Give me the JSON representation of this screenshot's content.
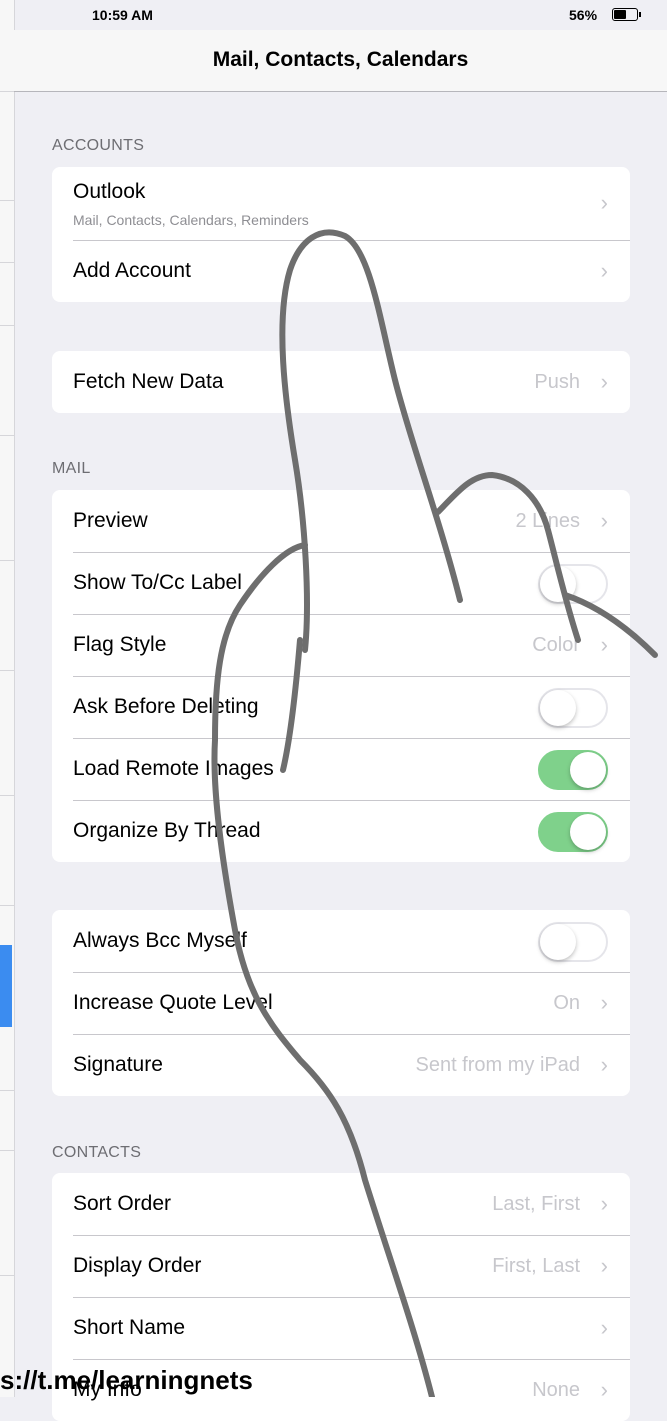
{
  "status_bar": {
    "time": "10:59 AM",
    "battery_percent": "56%",
    "battery_level": 0.56
  },
  "nav": {
    "title": "Mail, Contacts, Calendars"
  },
  "sections": {
    "accounts": {
      "header": "ACCOUNTS",
      "rows": [
        {
          "label": "Outlook",
          "subtitle": "Mail, Contacts, Calendars, Reminders"
        },
        {
          "label": "Add Account"
        }
      ]
    },
    "fetch": {
      "rows": [
        {
          "label": "Fetch New Data",
          "value": "Push"
        }
      ]
    },
    "mail": {
      "header": "MAIL",
      "rows": [
        {
          "label": "Preview",
          "value": "2 Lines"
        },
        {
          "label": "Show To/Cc Label",
          "toggle": false
        },
        {
          "label": "Flag Style",
          "value": "Color"
        },
        {
          "label": "Ask Before Deleting",
          "toggle": false
        },
        {
          "label": "Load Remote Images",
          "toggle": true
        },
        {
          "label": "Organize By Thread",
          "toggle": true
        }
      ]
    },
    "compose": {
      "rows": [
        {
          "label": "Always Bcc Myself",
          "toggle": false
        },
        {
          "label": "Increase Quote Level",
          "value": "On"
        },
        {
          "label": "Signature",
          "value": "Sent from my iPad"
        }
      ]
    },
    "contacts": {
      "header": "CONTACTS",
      "rows": [
        {
          "label": "Sort Order",
          "value": "Last, First"
        },
        {
          "label": "Display Order",
          "value": "First, Last"
        },
        {
          "label": "Short Name"
        },
        {
          "label": "My Info",
          "value": "None"
        }
      ]
    }
  },
  "chevron_glyph": "›",
  "watermark": "s://t.me/learningnets",
  "colors": {
    "toggle_on": "#7fd18b",
    "background": "#efeff4",
    "secondary_text": "#c7c7cc"
  }
}
